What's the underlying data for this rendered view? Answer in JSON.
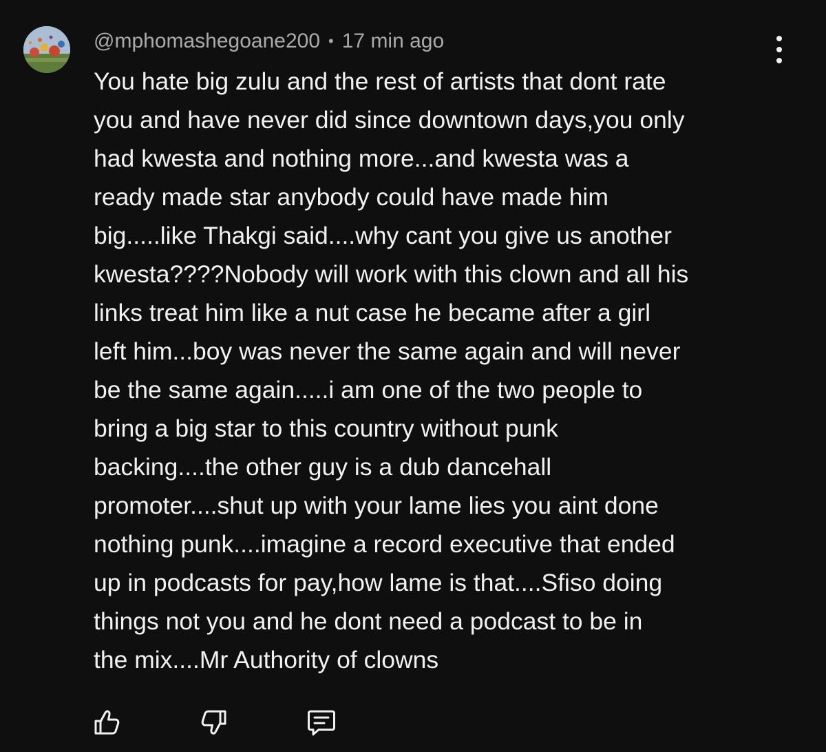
{
  "comment": {
    "author": "@mphomashegoane200",
    "separator": "•",
    "timestamp": "17 min ago",
    "body_lines": [
      "You hate big zulu and the rest of artists that dont rate",
      "you and have never did since downtown days,you only",
      "had kwesta and nothing more...and kwesta was a",
      "ready made star anybody could have made him",
      "big.....like Thakgi said....why cant you give us another",
      "kwesta????Nobody will work with this clown and all his",
      "links treat him like a nut case he became after a girl",
      "left him...boy was never the same again and will never",
      "be the same again.....i am one of the two people to",
      "bring a big star to this country without punk",
      "backing....the other guy is a dub dancehall",
      "promoter....shut up with your lame lies you aint done",
      "nothing punk....imagine a record executive that ended",
      "up in podcasts for pay,how lame is that....Sfiso doing",
      "things not you and he dont need a podcast to be in",
      "the mix....Mr Authority of clowns"
    ],
    "icons": {
      "avatar": "avatar-hot-air-balloons",
      "menu": "more-vertical-icon",
      "like": "thumbs-up-icon",
      "dislike": "thumbs-down-icon",
      "reply": "reply-comment-icon"
    }
  },
  "theme": {
    "background": "#0f0f0f",
    "text": "#f1f1f1",
    "meta_text": "#aaaaaa"
  }
}
